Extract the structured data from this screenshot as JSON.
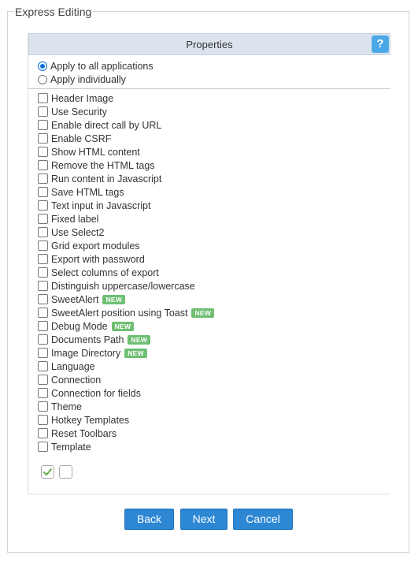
{
  "window": {
    "title": "Express Editing"
  },
  "panel": {
    "title": "Properties",
    "help_label": "?"
  },
  "apply_mode": {
    "selected": "Apply to all applications",
    "options": [
      "Apply to all applications",
      "Apply individually"
    ]
  },
  "options": [
    {
      "label": "Header Image",
      "checked": false,
      "new": false
    },
    {
      "label": "Use Security",
      "checked": false,
      "new": false
    },
    {
      "label": "Enable direct call by URL",
      "checked": false,
      "new": false
    },
    {
      "label": "Enable CSRF",
      "checked": false,
      "new": false
    },
    {
      "label": "Show HTML content",
      "checked": false,
      "new": false
    },
    {
      "label": "Remove the HTML tags",
      "checked": false,
      "new": false
    },
    {
      "label": "Run content in Javascript",
      "checked": false,
      "new": false
    },
    {
      "label": "Save HTML tags",
      "checked": false,
      "new": false
    },
    {
      "label": "Text input in Javascript",
      "checked": false,
      "new": false
    },
    {
      "label": "Fixed label",
      "checked": false,
      "new": false
    },
    {
      "label": "Use Select2",
      "checked": false,
      "new": false
    },
    {
      "label": "Grid export modules",
      "checked": false,
      "new": false
    },
    {
      "label": "Export with password",
      "checked": false,
      "new": false
    },
    {
      "label": "Select columns of export",
      "checked": false,
      "new": false
    },
    {
      "label": "Distinguish uppercase/lowercase",
      "checked": false,
      "new": false
    },
    {
      "label": "SweetAlert",
      "checked": false,
      "new": true
    },
    {
      "label": "SweetAlert position using Toast",
      "checked": false,
      "new": true
    },
    {
      "label": "Debug Mode",
      "checked": false,
      "new": true
    },
    {
      "label": "Documents Path",
      "checked": false,
      "new": true
    },
    {
      "label": "Image Directory",
      "checked": false,
      "new": true
    },
    {
      "label": "Language",
      "checked": false,
      "new": false
    },
    {
      "label": "Connection",
      "checked": false,
      "new": false
    },
    {
      "label": "Connection for fields",
      "checked": false,
      "new": false
    },
    {
      "label": "Theme",
      "checked": false,
      "new": false
    },
    {
      "label": "Hotkey Templates",
      "checked": false,
      "new": false
    },
    {
      "label": "Reset Toolbars",
      "checked": false,
      "new": false
    },
    {
      "label": "Template",
      "checked": false,
      "new": false
    }
  ],
  "new_badge_label": "NEW",
  "select_all_icon": "check-all-icon",
  "select_none_icon": "uncheck-all-icon",
  "buttons": {
    "back": "Back",
    "next": "Next",
    "cancel": "Cancel"
  },
  "colors": {
    "button_blue": "#2d87d3",
    "new_badge": "#6fbf73",
    "help_blue": "#4ba8e6",
    "header_bg": "#dbe3ee"
  }
}
